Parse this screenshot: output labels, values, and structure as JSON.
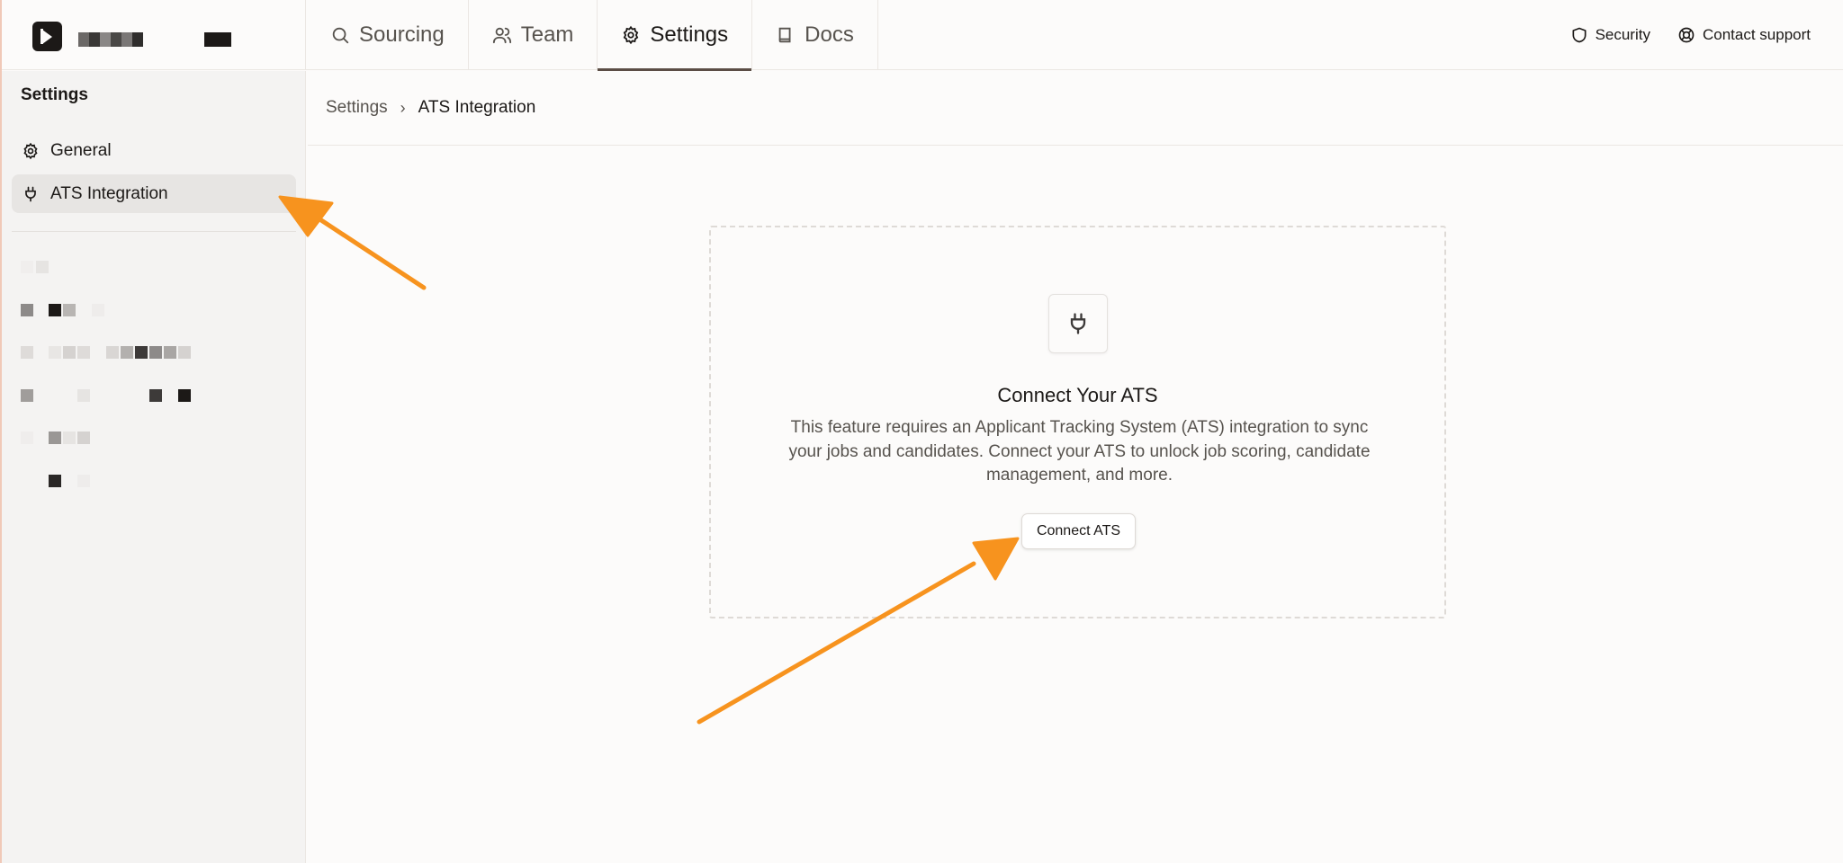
{
  "header": {
    "tabs": [
      {
        "label": "Sourcing",
        "icon": "search-icon"
      },
      {
        "label": "Team",
        "icon": "users-icon"
      },
      {
        "label": "Settings",
        "icon": "gear-icon",
        "active": true
      },
      {
        "label": "Docs",
        "icon": "book-icon"
      }
    ],
    "security_label": "Security",
    "support_label": "Contact support"
  },
  "sidebar": {
    "title": "Settings",
    "items": [
      {
        "label": "General",
        "icon": "gear-icon"
      },
      {
        "label": "ATS Integration",
        "icon": "plug-icon",
        "active": true
      }
    ]
  },
  "breadcrumb": {
    "root": "Settings",
    "separator": "›",
    "current": "ATS Integration"
  },
  "empty_state": {
    "icon": "plug-icon",
    "title": "Connect Your ATS",
    "description": "This feature requires an Applicant Tracking System (ATS) integration to sync your jobs and candidates. Connect your ATS to unlock job scoring, candidate management, and more.",
    "button_label": "Connect ATS"
  },
  "colors": {
    "accent_arrow": "#f7931e",
    "active_tab_underline": "#5b4d45",
    "text_primary": "#1c1917",
    "text_muted": "#57534e"
  }
}
